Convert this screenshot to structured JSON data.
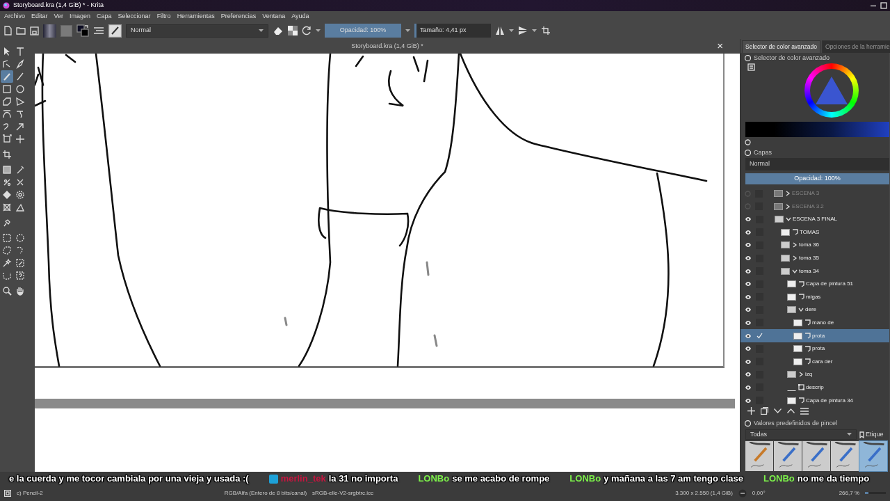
{
  "window": {
    "title": "Storyboard.kra (1,4 GiB) * - Krita"
  },
  "menu": [
    "Archivo",
    "Editar",
    "Ver",
    "Imagen",
    "Capa",
    "Seleccionar",
    "Filtro",
    "Herramientas",
    "Preferencias",
    "Ventana",
    "Ayuda"
  ],
  "toolbar": {
    "blend_mode": "Normal",
    "opacity": {
      "label": "Opacidad: 100%",
      "level": 1
    },
    "size": {
      "label": "Tamaño: 4,41 px",
      "level": 0.03
    }
  },
  "toolbox": {
    "tools": [
      {
        "kind": "pointer",
        "selected": false
      },
      {
        "kind": "text",
        "selected": false
      },
      {
        "kind": "edit-shapes",
        "selected": false
      },
      {
        "kind": "calligraphy",
        "selected": false
      },
      {
        "kind": "brush",
        "selected": true
      },
      {
        "kind": "line",
        "selected": false
      },
      {
        "kind": "rectangle",
        "selected": false
      },
      {
        "kind": "ellipse",
        "selected": false
      },
      {
        "kind": "polygon",
        "selected": false
      },
      {
        "kind": "polyline",
        "selected": false
      },
      {
        "kind": "bezier",
        "selected": false
      },
      {
        "kind": "freehand-path",
        "selected": false
      },
      {
        "kind": "dynamic",
        "selected": false
      },
      {
        "kind": "multibrush",
        "selected": false
      },
      {
        "kind": "transform",
        "selected": false
      },
      {
        "kind": "move",
        "selected": false
      },
      {
        "kind": "crop",
        "selected": false
      },
      {
        "kind": "gradient",
        "selected": false
      },
      {
        "kind": "picker",
        "selected": false
      },
      {
        "kind": "colorize",
        "selected": false
      },
      {
        "kind": "patch",
        "selected": false
      },
      {
        "kind": "fill",
        "selected": false
      },
      {
        "kind": "enclose",
        "selected": false
      },
      {
        "kind": "assistant",
        "selected": false
      },
      {
        "kind": "measure",
        "selected": false
      },
      {
        "kind": "reference",
        "selected": false
      },
      {
        "kind": "rect-select",
        "selected": false
      },
      {
        "kind": "ellipse-select",
        "selected": false
      },
      {
        "kind": "polygon-select",
        "selected": false
      },
      {
        "kind": "freehand-select",
        "selected": false
      },
      {
        "kind": "wand-select",
        "selected": false
      },
      {
        "kind": "similar-select",
        "selected": false
      },
      {
        "kind": "bezier-select",
        "selected": false
      },
      {
        "kind": "magnetic-select",
        "selected": false
      },
      {
        "kind": "zoom",
        "selected": false
      },
      {
        "kind": "pan",
        "selected": false
      }
    ]
  },
  "document_tab": {
    "title": "Storyboard.kra (1,4 GiB) *",
    "close": "×"
  },
  "docker_tabs": [
    {
      "label": "Selector de color avanzado",
      "selected": true
    },
    {
      "label": "Opciones de la herramie",
      "selected": false
    }
  ],
  "color_selector": {
    "title": "Selector de color avanzado"
  },
  "layers": {
    "title": "Capas",
    "blend_mode": "Normal",
    "opacity": {
      "label": "Opacidad:  100%",
      "level": 1
    },
    "items": [
      {
        "name": "ESCENA 3",
        "kind": "group",
        "visible": false,
        "selected": false,
        "expanded": false
      },
      {
        "name": "ESCENA 3.2",
        "kind": "group",
        "visible": false,
        "selected": false,
        "expanded": false
      },
      {
        "name": "ESCENA 3 FINAL",
        "kind": "group",
        "visible": true,
        "selected": false,
        "expanded": true,
        "children": [
          {
            "name": "TOMAS",
            "kind": "paint",
            "visible": true,
            "selected": false
          },
          {
            "name": "toma 36",
            "kind": "group",
            "visible": true,
            "selected": false,
            "expanded": false
          },
          {
            "name": "toma 35",
            "kind": "group",
            "visible": true,
            "selected": false,
            "expanded": false
          },
          {
            "name": "toma 34",
            "kind": "group",
            "visible": true,
            "selected": false,
            "expanded": true,
            "children": [
              {
                "name": "Capa de pintura 51",
                "kind": "paint",
                "visible": true,
                "selected": false
              },
              {
                "name": "migas",
                "kind": "paint",
                "visible": true,
                "selected": false
              },
              {
                "name": "dere",
                "kind": "group",
                "visible": true,
                "selected": false,
                "expanded": true,
                "children": [
                  {
                    "name": "mano de",
                    "kind": "paint",
                    "visible": true,
                    "selected": false
                  },
                  {
                    "name": "prota",
                    "kind": "paint",
                    "visible": true,
                    "selected": true
                  },
                  {
                    "name": "prota",
                    "kind": "paint",
                    "visible": true,
                    "selected": false
                  },
                  {
                    "name": "cara der",
                    "kind": "paint",
                    "visible": true,
                    "selected": false
                  }
                ]
              },
              {
                "name": "izq",
                "kind": "group",
                "visible": true,
                "selected": false,
                "expanded": false
              },
              {
                "name": "descrip",
                "kind": "vector",
                "visible": true,
                "selected": false
              },
              {
                "name": "Capa de pintura 34",
                "kind": "paint",
                "visible": true,
                "selected": false
              }
            ]
          }
        ]
      }
    ]
  },
  "brush_presets": {
    "title": "Valores predefinidos de pincel",
    "filter": "Todas",
    "tag_button": "Etique",
    "presets": [
      {
        "selected": false
      },
      {
        "selected": false
      },
      {
        "selected": false
      },
      {
        "selected": false
      },
      {
        "selected": true
      }
    ]
  },
  "status_bar": {
    "brush": "c) Pencil-2",
    "color_space": "RGB/Alfa (Entero de 8 bits/canal)",
    "profile": "sRGB-elle-V2-srgbtrc.icc",
    "dimensions": "3.300 x 2.550 (1,4 GiB)",
    "rotation": "0,00°",
    "zoom": "266,7 %",
    "zoom_slider": {
      "level": 0.15
    }
  },
  "chat_ticker": [
    {
      "text": "e la cuerda y me tocor cambiala por una vieja y usada :(",
      "badge": false
    },
    {
      "user": "merlin_tek",
      "color": "#c8143f",
      "badge": true,
      "text": "la 31 no importa"
    },
    {
      "user": "LONBo",
      "color": "#7cf14a",
      "badge": false,
      "text": "se me acabo de rompe"
    },
    {
      "user": "LONBo",
      "color": "#7cf14a",
      "badge": false,
      "text": "y mañana a las 7 am tengo clase"
    },
    {
      "user": "LONBo",
      "color": "#7cf14a",
      "badge": false,
      "text": "no me da tiempo"
    }
  ]
}
